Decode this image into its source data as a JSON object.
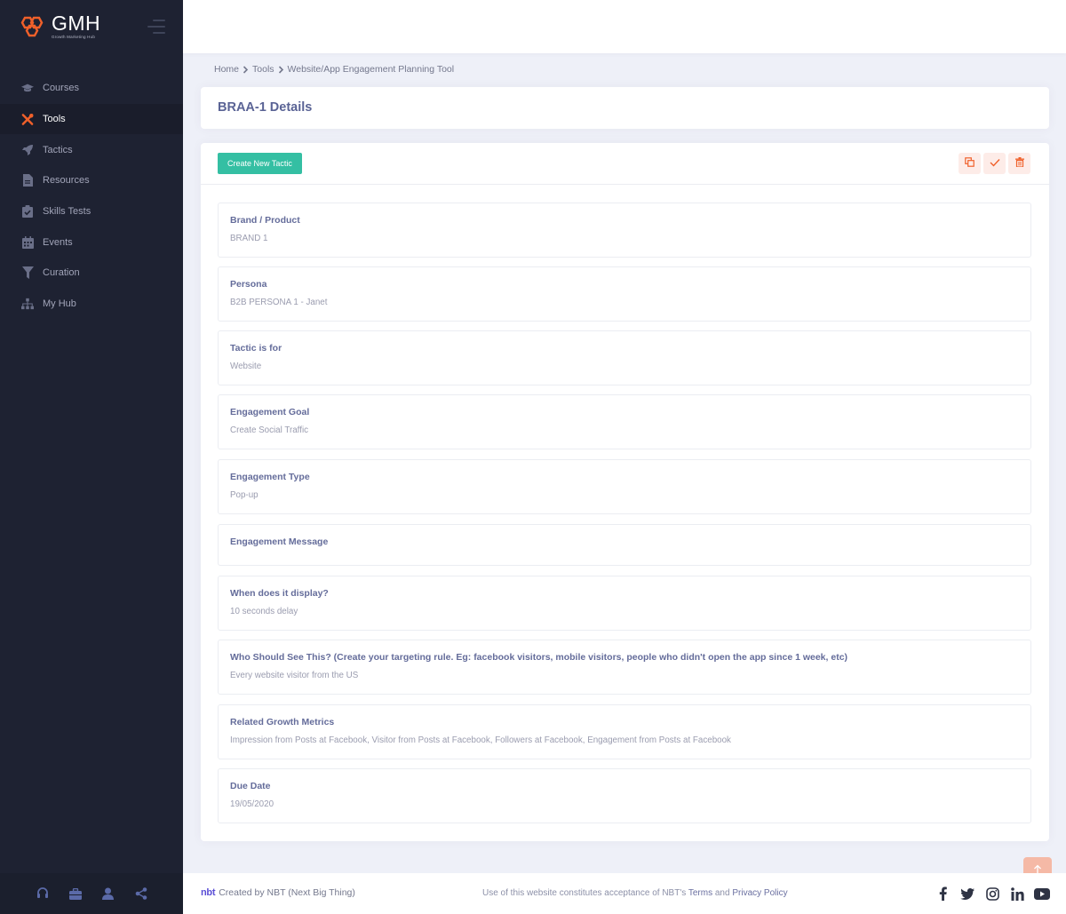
{
  "brand": {
    "name": "GMH",
    "subtitle": "Growth Marketing Hub"
  },
  "sidebar": {
    "items": [
      {
        "label": "Courses",
        "icon": "graduation-cap-icon",
        "active": false
      },
      {
        "label": "Tools",
        "icon": "tools-icon",
        "active": true
      },
      {
        "label": "Tactics",
        "icon": "rocket-icon",
        "active": false
      },
      {
        "label": "Resources",
        "icon": "document-icon",
        "active": false
      },
      {
        "label": "Skills Tests",
        "icon": "clipboard-check-icon",
        "active": false
      },
      {
        "label": "Events",
        "icon": "calendar-icon",
        "active": false
      },
      {
        "label": "Curation",
        "icon": "filter-icon",
        "active": false
      },
      {
        "label": "My Hub",
        "icon": "sitemap-icon",
        "active": false
      }
    ],
    "footer_icons": [
      "headset-icon",
      "briefcase-icon",
      "user-icon",
      "share-icon"
    ]
  },
  "breadcrumb": {
    "home": "Home",
    "tools": "Tools",
    "current": "Website/App Engagement Planning Tool"
  },
  "page": {
    "title": "BRAA-1 Details"
  },
  "toolbar": {
    "create_label": "Create New Tactic"
  },
  "fields": [
    {
      "label": "Brand / Product",
      "value": "BRAND 1"
    },
    {
      "label": "Persona",
      "value": "B2B PERSONA 1 - Janet"
    },
    {
      "label": "Tactic is for",
      "value": "Website"
    },
    {
      "label": "Engagement Goal",
      "value": "Create Social Traffic"
    },
    {
      "label": "Engagement Type",
      "value": "Pop-up"
    },
    {
      "label": "Engagement Message",
      "value": ""
    },
    {
      "label": "When does it display?",
      "value": "10 seconds delay"
    },
    {
      "label": "Who Should See This? (Create your targeting rule. Eg: facebook visitors, mobile visitors, people who didn't open the app since 1 week, etc)",
      "value": "Every website visitor from the US"
    },
    {
      "label": "Related Growth Metrics",
      "value": "Impression from Posts at Facebook, Visitor from Posts at Facebook, Followers at Facebook, Engagement from Posts at Facebook"
    },
    {
      "label": "Due Date",
      "value": "19/05/2020"
    }
  ],
  "footer": {
    "logo": "nbt",
    "created_by": "Created by",
    "company": "NBT (Next Big Thing)",
    "notice": "Use of this website constitutes acceptance of NBT's",
    "terms": "Terms",
    "and": "and",
    "privacy": "Privacy Policy",
    "social": [
      "facebook-icon",
      "twitter-icon",
      "instagram-icon",
      "linkedin-icon",
      "youtube-icon"
    ]
  },
  "colors": {
    "accent": "#f0602a",
    "primary_btn": "#34bfa3",
    "sidebar_bg": "#1e2232",
    "title": "#5a6395"
  }
}
